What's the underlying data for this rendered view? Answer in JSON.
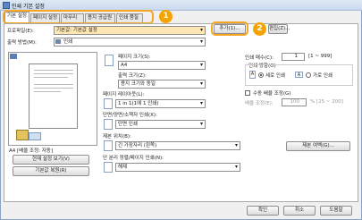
{
  "window": {
    "title": "인쇄 기본 설정"
  },
  "tabs": [
    {
      "label": "기본 설정"
    },
    {
      "label": "페이지 설정"
    },
    {
      "label": "마무리"
    },
    {
      "label": "용지 공급원"
    },
    {
      "label": "인쇄 품질"
    }
  ],
  "callouts": {
    "one": "1",
    "two": "2"
  },
  "profile": {
    "label": "프로파일(E):",
    "value": "기본값: 기본값 설정",
    "add_button": "추가(1)...",
    "edit_button": "편집(Z)..."
  },
  "output_method": {
    "label": "출력 방법(M):",
    "value": "인쇄"
  },
  "preview": {
    "status_text": "A4 [배율 조정: 자동]",
    "view_settings_button": "현재 설정 보기(V)",
    "restore_defaults_button": "기본값 복원(R)"
  },
  "page_settings": {
    "page_size_label": "페이지 크기(S):",
    "page_size_value": "A4",
    "output_size_label": "출력 크기(Z):",
    "output_size_value": "용지 크기와 동일",
    "page_layout_label": "페이지 레이아웃(L):",
    "page_layout_value": "1 in 1(1에 1 인쇄)",
    "duplex_label": "단면/양면/소책자 인쇄(X):",
    "duplex_value": "단면 인쇄",
    "staple_label": "제본 위치(B):",
    "staple_value": "긴 가장자리 (왼쪽)",
    "finishing_label": "단 분리 정렬/페이지 인쇄(N):",
    "finishing_value": "해제",
    "binding_button": "제본 여백(G)..."
  },
  "copies": {
    "label": "인쇄 매수(C):",
    "value": "1",
    "range": "[1 ~ 999]",
    "orientation_label": "인쇄 방향(O)",
    "portrait_label": "세로 인쇄",
    "landscape_label": "가로 인쇄"
  },
  "manual_scaling": {
    "label": "수동 배율 조정(G)",
    "scale_label": "배율 조정(E):",
    "scale_value": "100",
    "scale_range": "% [25 ~ 200]"
  },
  "footer": {
    "ok_button": "확인",
    "cancel_button": "취소",
    "help_button": "도움말"
  }
}
